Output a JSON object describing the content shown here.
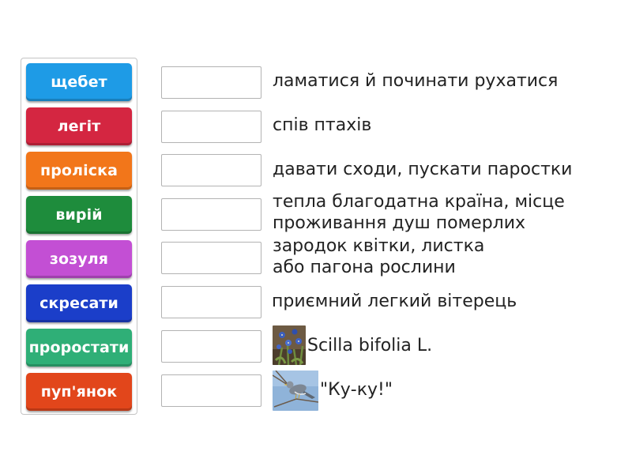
{
  "tiles": [
    {
      "label": "щебет",
      "color": "#1e9be6"
    },
    {
      "label": "легіт",
      "color": "#d42641"
    },
    {
      "label": "проліска",
      "color": "#f2761a"
    },
    {
      "label": "вирій",
      "color": "#1e8c3c"
    },
    {
      "label": "зозуля",
      "color": "#c34fd4"
    },
    {
      "label": "скресати",
      "color": "#1b3ec9"
    },
    {
      "label": "проростати",
      "color": "#2faf77"
    },
    {
      "label": "пуп'янок",
      "color": "#e2461b"
    }
  ],
  "definitions": [
    {
      "text": "ламатися й починати рухатися"
    },
    {
      "text": "спів птахів"
    },
    {
      "text": "давати сходи, пускати паростки"
    },
    {
      "line1": "тепла благодатна країна, місце",
      "line2": "проживання душ померлих"
    },
    {
      "line1": "зародок квітки, листка",
      "line2": "або пагона рослини"
    },
    {
      "text": "приємний легкий вітерець"
    },
    {
      "text": "Scilla bifolia L.",
      "image": "scilla-flower-photo"
    },
    {
      "text": "\"Ку-ку!\"",
      "image": "cuckoo-bird-photo"
    }
  ]
}
